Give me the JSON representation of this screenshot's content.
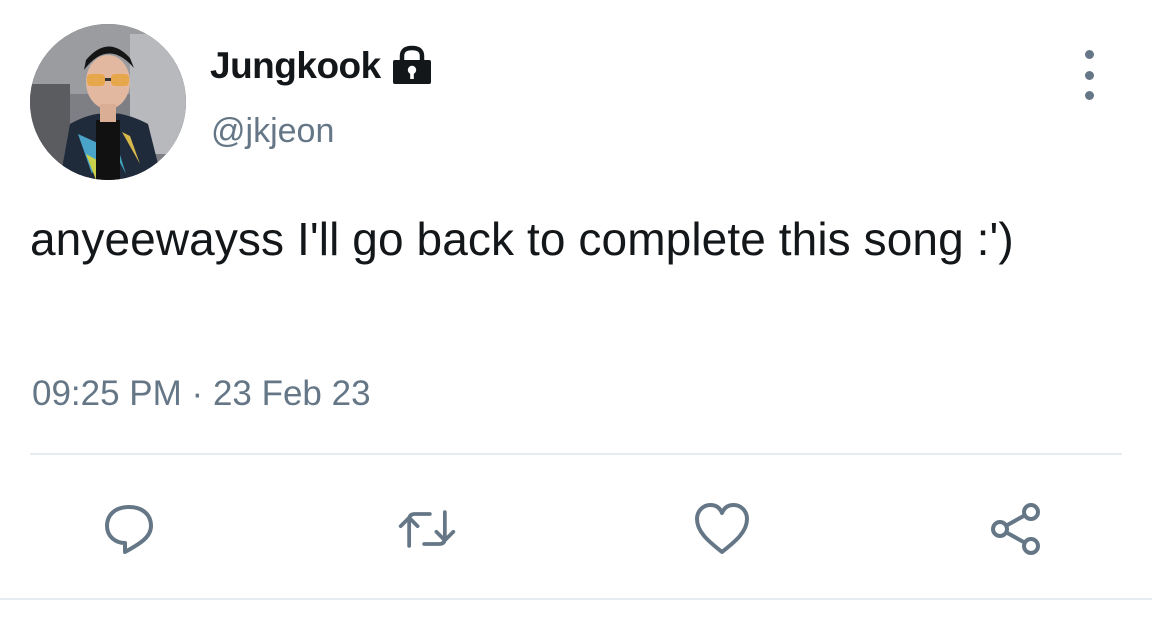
{
  "user": {
    "display_name": "Jungkook",
    "handle": "@jkjeon",
    "protected_icon": "lock-icon",
    "avatar_icon": "profile-photo"
  },
  "tweet": {
    "text": "anyeewayss I'll go back to complete this song :')",
    "time": "09:25 PM",
    "separator": "·",
    "date": "23 Feb 23"
  },
  "actions": {
    "reply_icon": "reply-icon",
    "retweet_icon": "retweet-icon",
    "like_icon": "like-icon",
    "share_icon": "share-icon",
    "more_icon": "more-options-icon"
  },
  "colors": {
    "text": "#14171a",
    "secondary": "#657786",
    "divider": "#e6ecf0",
    "background": "#ffffff"
  }
}
